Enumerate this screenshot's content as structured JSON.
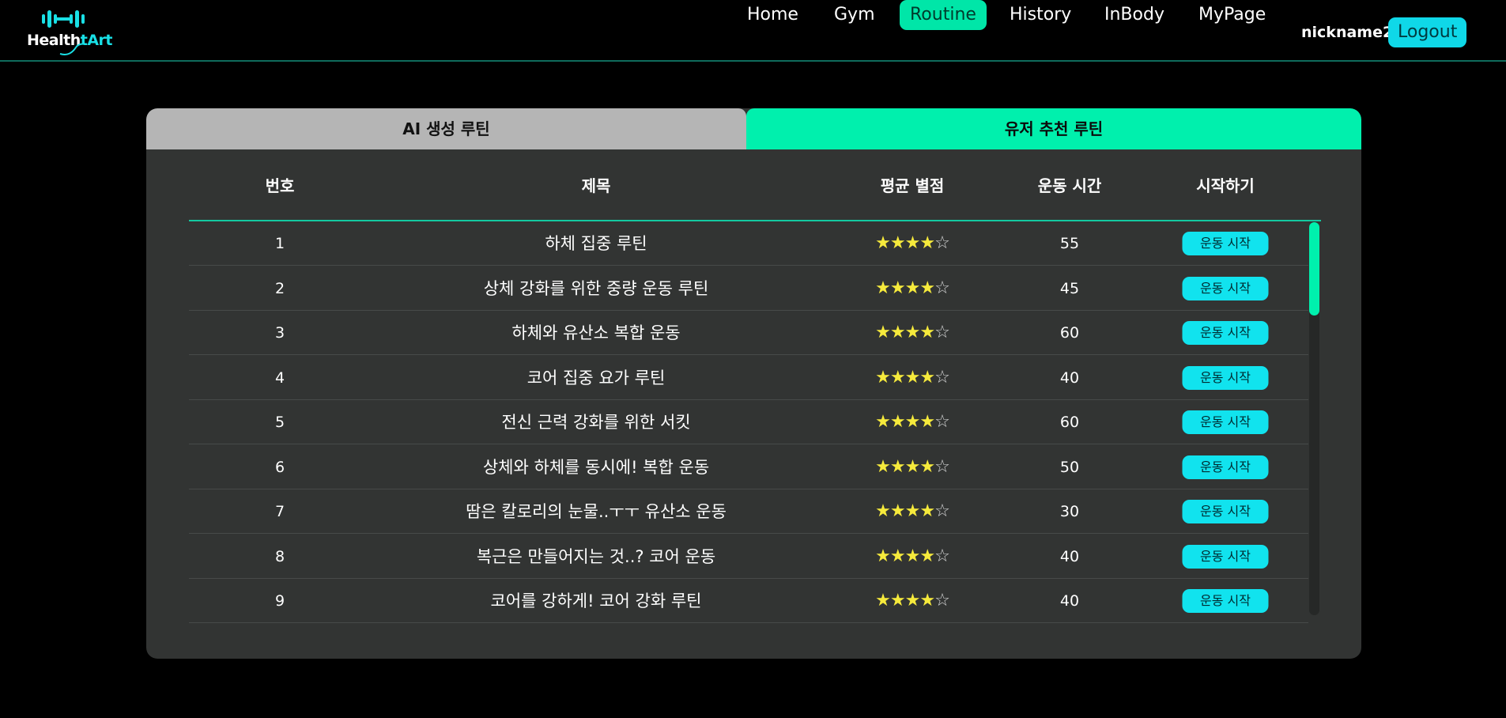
{
  "brand": {
    "name_white": "Health",
    "name_cyan": "tArt",
    "accent": "#19e0e6"
  },
  "nav": {
    "items": [
      {
        "label": "Home"
      },
      {
        "label": "Gym"
      },
      {
        "label": "Routine",
        "active": true
      },
      {
        "label": "History"
      },
      {
        "label": "InBody"
      },
      {
        "label": "MyPage"
      }
    ],
    "nickname": "nickname2",
    "logout_label": "Logout"
  },
  "tabs": {
    "ai_label": "AI 생성 루틴",
    "user_label": "유저 추천 루틴",
    "active": "user"
  },
  "table": {
    "headers": {
      "number": "번호",
      "title": "제목",
      "rating": "평균 별점",
      "duration": "운동 시간",
      "start": "시작하기"
    },
    "start_button_label": "운동 시작",
    "rows": [
      {
        "number": "1",
        "title": "하체 집중 루틴",
        "stars": 4,
        "max_stars": 5,
        "duration": "55"
      },
      {
        "number": "2",
        "title": "상체 강화를 위한 중량 운동 루틴",
        "stars": 4,
        "max_stars": 5,
        "duration": "45"
      },
      {
        "number": "3",
        "title": "하체와 유산소 복합 운동",
        "stars": 4,
        "max_stars": 5,
        "duration": "60"
      },
      {
        "number": "4",
        "title": "코어 집중 요가 루틴",
        "stars": 4,
        "max_stars": 5,
        "duration": "40"
      },
      {
        "number": "5",
        "title": "전신 근력 강화를 위한 서킷",
        "stars": 4,
        "max_stars": 5,
        "duration": "60"
      },
      {
        "number": "6",
        "title": "상체와 하체를 동시에! 복합 운동",
        "stars": 4,
        "max_stars": 5,
        "duration": "50"
      },
      {
        "number": "7",
        "title": "땀은 칼로리의 눈물..ㅜㅜ 유산소 운동",
        "stars": 4,
        "max_stars": 5,
        "duration": "30"
      },
      {
        "number": "8",
        "title": "복근은 만들어지는 것..? 코어 운동",
        "stars": 4,
        "max_stars": 5,
        "duration": "40"
      },
      {
        "number": "9",
        "title": "코어를 강하게! 코어 강화 루틴",
        "stars": 4,
        "max_stars": 5,
        "duration": "40"
      }
    ]
  },
  "colors": {
    "nav_active_bg": "#00e6a8",
    "logout_bg": "#0fd8e8",
    "tab_active_bg": "#00f0ad",
    "tab_inactive_bg": "#b5b5b5",
    "card_bg": "#323433",
    "star_on": "#f6ea3c",
    "button_bg": "#11e3ee"
  }
}
